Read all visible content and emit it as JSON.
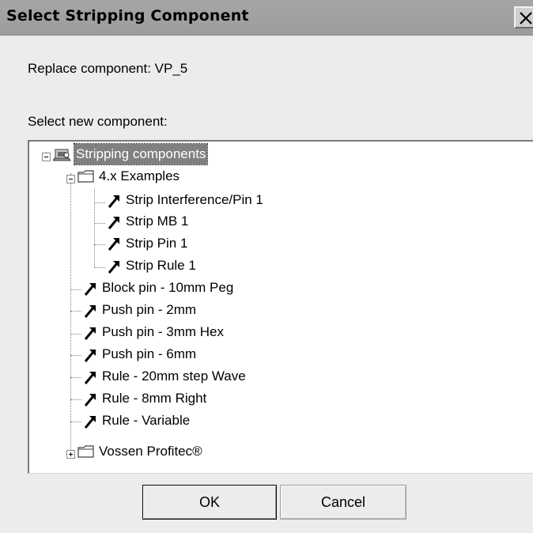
{
  "window": {
    "title": "Select Stripping Component",
    "close_glyph": "✕"
  },
  "replace_label": "Replace component: VP_5",
  "select_label": "Select new component:",
  "tree": {
    "root": {
      "label": "Stripping components",
      "icon": "component-library-icon",
      "expanded": true,
      "selected": true
    },
    "folder_examples": {
      "label": "4.x Examples",
      "icon": "folder-icon",
      "expanded": true
    },
    "examples": [
      {
        "label": "Strip Interference/Pin 1",
        "icon": "tool-icon"
      },
      {
        "label": "Strip MB 1",
        "icon": "tool-icon"
      },
      {
        "label": "Strip Pin 1",
        "icon": "tool-icon"
      },
      {
        "label": "Strip Rule 1",
        "icon": "tool-icon"
      }
    ],
    "items": [
      {
        "label": "Block pin - 10mm Peg",
        "icon": "tool-icon"
      },
      {
        "label": "Push pin - 2mm",
        "icon": "tool-icon"
      },
      {
        "label": "Push pin - 3mm Hex",
        "icon": "tool-icon"
      },
      {
        "label": "Push pin - 6mm",
        "icon": "tool-icon"
      },
      {
        "label": "Rule - 20mm step Wave",
        "icon": "tool-icon"
      },
      {
        "label": "Rule - 8mm Right",
        "icon": "tool-icon"
      },
      {
        "label": "Rule - Variable",
        "icon": "tool-icon"
      }
    ],
    "folder_vossen": {
      "label": "Vossen Profitec®",
      "icon": "folder-icon",
      "expanded": false
    }
  },
  "buttons": {
    "ok": "OK",
    "cancel": "Cancel"
  }
}
